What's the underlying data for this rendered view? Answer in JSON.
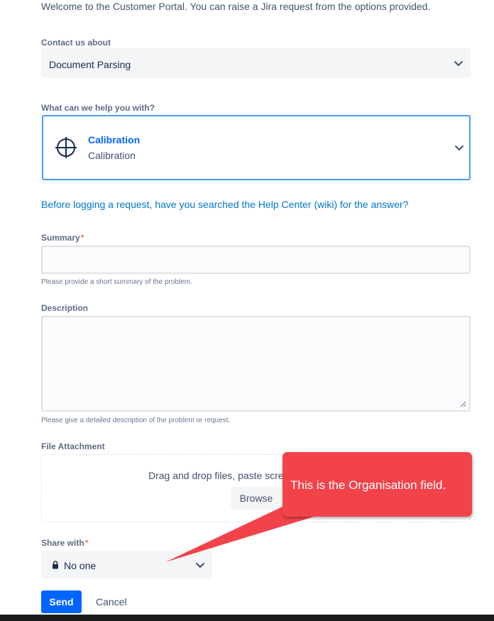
{
  "intro": "Welcome to the Customer Portal. You can raise a Jira request from the options provided.",
  "contact": {
    "label": "Contact us about",
    "value": "Document Parsing"
  },
  "help_with": {
    "label": "What can we help you with?",
    "title": "Calibration",
    "description": "Calibration",
    "icon": "crosshair-icon"
  },
  "help_link": "Before logging a request, have you searched the Help Center (wiki) for the answer?",
  "summary": {
    "label": "Summary",
    "required_mark": "*",
    "value": "",
    "hint": "Please provide a short summary of the problem."
  },
  "description": {
    "label": "Description",
    "value": "",
    "hint": "Please give a detailed description of the problem or request."
  },
  "attachment": {
    "label": "File Attachment",
    "drop_text": "Drag and drop files, paste screenshots, or",
    "browse_label": "Browse"
  },
  "share": {
    "label": "Share with",
    "required_mark": "*",
    "value": "No one",
    "icon": "lock-icon"
  },
  "actions": {
    "send_label": "Send",
    "cancel_label": "Cancel"
  },
  "callout": {
    "text": "This is the Organisation field.",
    "color": "#f2434a"
  },
  "colors": {
    "primary": "#0065ff",
    "link": "#0077cc",
    "required": "#de350b",
    "focus_border": "#4c9aff"
  }
}
